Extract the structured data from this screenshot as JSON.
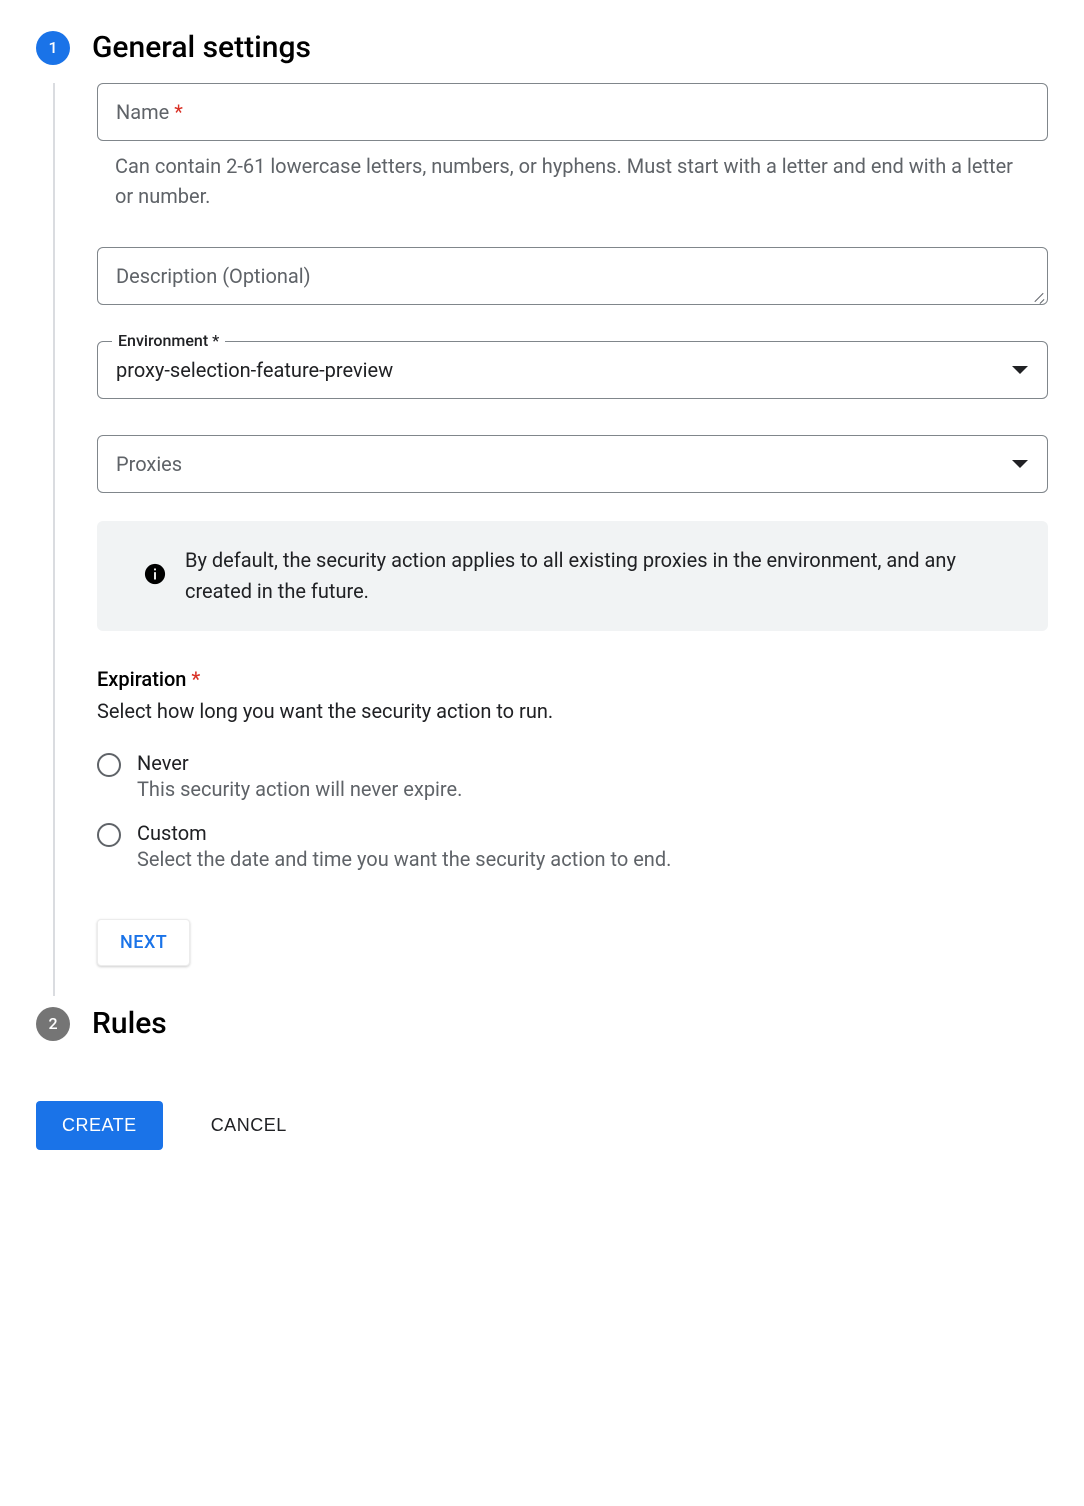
{
  "steps": {
    "one_number": "1",
    "one_title": "General settings",
    "two_number": "2",
    "two_title": "Rules"
  },
  "name": {
    "label": "Name",
    "required_mark": " *",
    "helper": "Can contain 2-61 lowercase letters, numbers, or hyphens. Must start with a letter and end with a letter or number."
  },
  "description": {
    "placeholder": "Description (Optional)"
  },
  "environment": {
    "label": "Environment *",
    "value": "proxy-selection-feature-preview"
  },
  "proxies": {
    "placeholder": "Proxies"
  },
  "info_box": {
    "text": "By default, the security action applies to all existing proxies in the environment, and any created in the future."
  },
  "expiration": {
    "label": "Expiration",
    "required_mark": " *",
    "description": "Select how long you want the security action to run.",
    "options": {
      "never": {
        "title": "Never",
        "sub": "This security action will never expire."
      },
      "custom": {
        "title": "Custom",
        "sub": "Select the date and time you want the security action to end."
      }
    }
  },
  "buttons": {
    "next": "NEXT",
    "create": "CREATE",
    "cancel": "CANCEL"
  }
}
